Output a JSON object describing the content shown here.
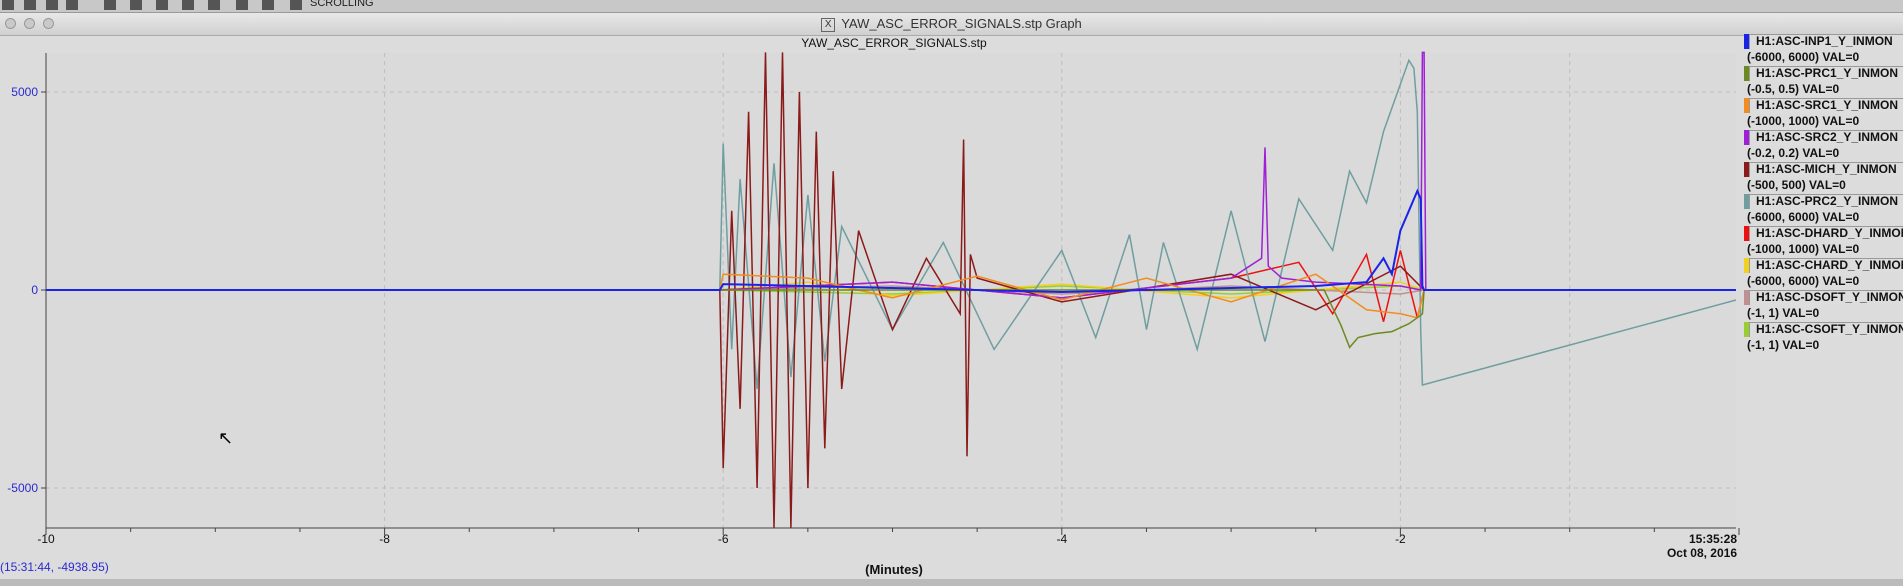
{
  "window": {
    "toolbar_label": "SCROLLING",
    "title": "YAW_ASC_ERROR_SIGNALS.stp Graph"
  },
  "status": {
    "coordinate_readout": "(15:31:44, -4938.95)",
    "end_time": "15:35:28",
    "end_date": "Oct 08, 2016"
  },
  "legend": [
    {
      "name": "H1:ASC-INP1_Y_INMON",
      "range": "(-6000, 6000) VAL=0",
      "color": "#1a24e8"
    },
    {
      "name": "H1:ASC-PRC1_Y_INMON",
      "range": "(-0.5, 0.5) VAL=0",
      "color": "#6b8a22"
    },
    {
      "name": "H1:ASC-SRC1_Y_INMON",
      "range": "(-1000, 1000) VAL=0",
      "color": "#f28c1e"
    },
    {
      "name": "H1:ASC-SRC2_Y_INMON",
      "range": "(-0.2, 0.2) VAL=0",
      "color": "#a020d8"
    },
    {
      "name": "H1:ASC-MICH_Y_INMON",
      "range": "(-500, 500) VAL=0",
      "color": "#8b1a1a"
    },
    {
      "name": "H1:ASC-PRC2_Y_INMON",
      "range": "(-6000, 6000) VAL=0",
      "color": "#6f9ea0"
    },
    {
      "name": "H1:ASC-DHARD_Y_INMON",
      "range": "(-1000, 1000) VAL=0",
      "color": "#ee1010"
    },
    {
      "name": "H1:ASC-CHARD_Y_INMON",
      "range": "(-6000, 6000) VAL=0",
      "color": "#f2d020"
    },
    {
      "name": "H1:ASC-DSOFT_Y_INMON",
      "range": "(-1, 1) VAL=0",
      "color": "#c09090"
    },
    {
      "name": "H1:ASC-CSOFT_Y_INMON",
      "range": "(-1, 1) VAL=0",
      "color": "#9acd32"
    }
  ],
  "chart_data": {
    "type": "line",
    "title": "YAW_ASC_ERROR_SIGNALS.stp",
    "xlabel": "(Minutes)",
    "ylabel": "",
    "xlim": [
      -10,
      0.2
    ],
    "ylim": [
      -6000,
      6000
    ],
    "xticks": [
      -10,
      -8,
      -6,
      -4,
      -2
    ],
    "yticks": [
      -5000,
      0,
      5000
    ],
    "grid": true,
    "legend_position": "right",
    "series": [
      {
        "name": "H1:ASC-INP1_Y_INMON",
        "color": "#1a24e8",
        "x": [
          -10,
          -6.02,
          -6.0,
          -5.0,
          -4.0,
          -3.0,
          -2.5,
          -2.2,
          -2.1,
          -2.05,
          -2.0,
          -1.95,
          -1.9,
          -1.88,
          -1.87,
          -1.86,
          0.2
        ],
        "y": [
          0,
          0,
          150,
          50,
          -50,
          50,
          100,
          200,
          800,
          400,
          1500,
          2000,
          2500,
          2300,
          100,
          0,
          0
        ]
      },
      {
        "name": "H1:ASC-PRC1_Y_INMON",
        "color": "#6b8a22",
        "x": [
          -10,
          -2.45,
          -2.35,
          -2.3,
          -2.25,
          -2.15,
          -2.05,
          -1.95,
          -1.9,
          -1.87,
          -1.86,
          0.2
        ],
        "y": [
          0,
          0,
          -900,
          -1450,
          -1200,
          -1100,
          -1050,
          -850,
          -700,
          -600,
          0,
          0
        ]
      },
      {
        "name": "H1:ASC-SRC1_Y_INMON",
        "color": "#f28c1e",
        "x": [
          -10,
          -6.02,
          -6.0,
          -5.5,
          -5.0,
          -4.5,
          -4.0,
          -3.5,
          -3.0,
          -2.5,
          -2.2,
          -2.0,
          -1.9,
          -1.86,
          0.2
        ],
        "y": [
          0,
          0,
          400,
          300,
          -200,
          350,
          -250,
          300,
          -300,
          400,
          -500,
          -600,
          -700,
          0,
          0
        ]
      },
      {
        "name": "H1:ASC-SRC2_Y_INMON",
        "color": "#a020d8",
        "x": [
          -10,
          -6.02,
          -5.0,
          -4.0,
          -3.0,
          -2.82,
          -2.8,
          -2.78,
          -2.7,
          -2.5,
          -2.0,
          -1.88,
          -1.87,
          -1.86,
          -1.85,
          0.2
        ],
        "y": [
          0,
          0,
          200,
          -200,
          300,
          800,
          3600,
          600,
          300,
          200,
          100,
          0,
          6000,
          6000,
          0,
          0
        ]
      },
      {
        "name": "H1:ASC-MICH_Y_INMON",
        "color": "#8b1a1a",
        "x": [
          -10,
          -6.02,
          -6.0,
          -5.95,
          -5.9,
          -5.85,
          -5.8,
          -5.75,
          -5.7,
          -5.65,
          -5.6,
          -5.55,
          -5.5,
          -5.45,
          -5.4,
          -5.35,
          -5.3,
          -5.2,
          -5.0,
          -4.8,
          -4.6,
          -4.58,
          -4.56,
          -4.54,
          -4.5,
          -4.0,
          -3.0,
          -2.5,
          -2.0,
          -1.86,
          0.2
        ],
        "y": [
          0,
          0,
          -4500,
          2000,
          -3000,
          4500,
          -5000,
          6000,
          -6000,
          6000,
          -6000,
          5000,
          -5000,
          4000,
          -4000,
          3000,
          -2500,
          1500,
          -1000,
          800,
          -600,
          3800,
          -4200,
          900,
          300,
          -300,
          400,
          -500,
          600,
          0,
          0
        ]
      },
      {
        "name": "H1:ASC-PRC2_Y_INMON",
        "color": "#6f9ea0",
        "x": [
          -10,
          -6.02,
          -6.0,
          -5.95,
          -5.9,
          -5.8,
          -5.7,
          -5.6,
          -5.5,
          -5.4,
          -5.3,
          -5.0,
          -4.7,
          -4.4,
          -4.0,
          -3.8,
          -3.6,
          -3.5,
          -3.4,
          -3.2,
          -3.0,
          -2.8,
          -2.6,
          -2.4,
          -2.3,
          -2.2,
          -2.1,
          -2.0,
          -1.95,
          -1.92,
          -1.9,
          -1.88,
          -1.87,
          0.2
        ],
        "y": [
          0,
          0,
          3700,
          -1500,
          2800,
          -2500,
          3200,
          -2200,
          2400,
          -1800,
          1600,
          -1000,
          1200,
          -1500,
          1000,
          -1200,
          1400,
          -1000,
          1200,
          -1500,
          2000,
          -1300,
          2300,
          1000,
          3000,
          2200,
          4000,
          5200,
          5800,
          5600,
          4500,
          -1000,
          -2400,
          0
        ]
      },
      {
        "name": "H1:ASC-DHARD_Y_INMON",
        "color": "#ee1010",
        "x": [
          -10,
          -6.02,
          -5.0,
          -4.0,
          -3.0,
          -2.6,
          -2.4,
          -2.2,
          -2.1,
          -2.0,
          -1.9,
          -1.86,
          0.2
        ],
        "y": [
          0,
          0,
          200,
          -200,
          300,
          700,
          -600,
          900,
          -800,
          1000,
          -700,
          0,
          0
        ]
      },
      {
        "name": "H1:ASC-CHARD_Y_INMON",
        "color": "#f2d020",
        "x": [
          -10,
          -6.02,
          -5.5,
          -5.0,
          -4.0,
          -3.0,
          -2.0,
          -1.86,
          0.2
        ],
        "y": [
          0,
          0,
          200,
          -150,
          150,
          -200,
          200,
          0,
          0
        ]
      },
      {
        "name": "H1:ASC-DSOFT_Y_INMON",
        "color": "#c09090",
        "x": [
          -10,
          -6.02,
          -5.0,
          -4.0,
          -3.0,
          -2.0,
          -1.86,
          0.2
        ],
        "y": [
          0,
          0,
          100,
          -100,
          100,
          -100,
          0,
          0
        ]
      },
      {
        "name": "H1:ASC-CSOFT_Y_INMON",
        "color": "#9acd32",
        "x": [
          -10,
          -6.02,
          -5.0,
          -4.0,
          -3.0,
          -2.0,
          -1.86,
          0.2
        ],
        "y": [
          0,
          0,
          -100,
          100,
          -100,
          100,
          0,
          0
        ]
      }
    ]
  }
}
